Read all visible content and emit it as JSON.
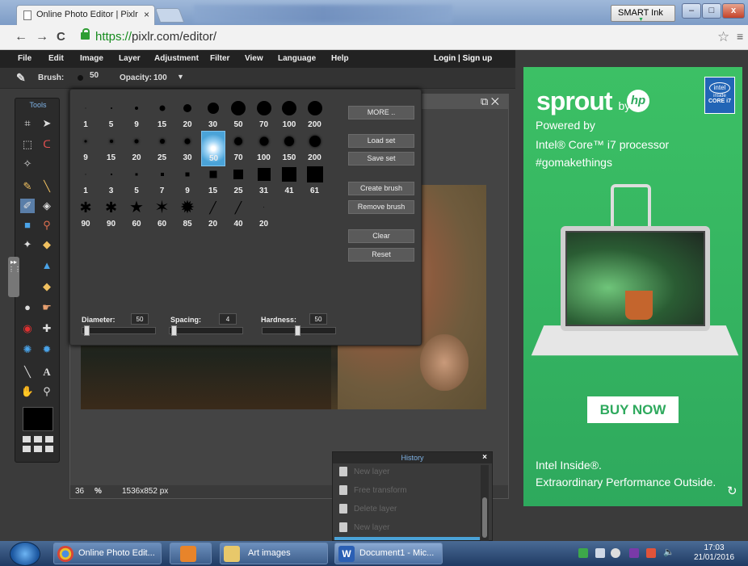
{
  "browser": {
    "tab_title": "Online Photo Editor | Pixlr",
    "tab_close": "×",
    "smart_ink": "SMART Ink",
    "url_https": "https://",
    "url_rest": "pixlr.com/editor/",
    "back": "←",
    "forward": "→",
    "reload": "C",
    "star": "☆",
    "menu": "≡",
    "min": "–",
    "max": "□",
    "close": "x"
  },
  "pixlr_menu": {
    "items": [
      "File",
      "Edit",
      "Image",
      "Layer",
      "Adjustment",
      "Filter",
      "View",
      "Language",
      "Help"
    ],
    "login": "Login  |  Sign up"
  },
  "options_bar": {
    "brush_label": "Brush:",
    "brush_size": "50",
    "opacity_label": "Opacity:",
    "opacity_value": "100"
  },
  "tools": {
    "title": "Tools"
  },
  "brush_panel": {
    "row1": [
      "1",
      "5",
      "9",
      "15",
      "20",
      "30",
      "50",
      "70",
      "100",
      "200"
    ],
    "row2": [
      "9",
      "15",
      "20",
      "25",
      "30",
      "50",
      "70",
      "100",
      "150",
      "200"
    ],
    "row3": [
      "1",
      "3",
      "5",
      "7",
      "9",
      "15",
      "25",
      "31",
      "41",
      "61"
    ],
    "row4": [
      "90",
      "90",
      "60",
      "60",
      "85",
      "20",
      "40",
      "20"
    ],
    "selected": "50",
    "buttons": {
      "more": "MORE ..",
      "load_set": "Load set",
      "save_set": "Save set",
      "create_brush": "Create brush",
      "remove_brush": "Remove brush",
      "clear": "Clear",
      "reset": "Reset"
    },
    "diameter_label": "Diameter:",
    "diameter_value": "50",
    "spacing_label": "Spacing:",
    "spacing_value": "4",
    "hardness_label": "Hardness:",
    "hardness_value": "50"
  },
  "canvas": {
    "zoom": "36",
    "zoom_unit": "%",
    "dimensions": "1536x852 px"
  },
  "history": {
    "title": "History",
    "items": [
      "New layer",
      "Free transform",
      "Delete layer",
      "New layer"
    ]
  },
  "ad": {
    "brand": "sprout",
    "by": "by",
    "powered_by": "Powered by",
    "processor": "Intel® Core™ i7 processor",
    "hashtag": "#gomakethings",
    "buy_now": "BUY NOW",
    "intel_inside": "Intel Inside®.",
    "tagline": "Extraordinary Performance Outside.",
    "badge_intel": "intel",
    "badge_inside": "inside",
    "badge_core": "CORE i7",
    "hp_logo": "hp"
  },
  "taskbar": {
    "chrome_item": "Online Photo Edit...",
    "art_item": "Art images",
    "word_item": "Document1 - Mic...",
    "time": "17:03",
    "date": "21/01/2016"
  }
}
